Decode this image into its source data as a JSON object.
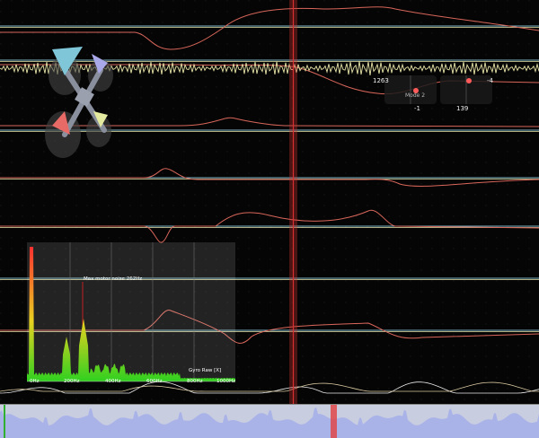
{
  "stick_display": {
    "left_stick": {
      "x_value": "1263",
      "y_value": "-1",
      "mode_label": "Mode 2"
    },
    "right_stick": {
      "x_value": "-4",
      "y_value": "139"
    }
  },
  "spectrum": {
    "title": "Max motor noise 262Hz",
    "axis_label": "Gyro Raw [X]",
    "ticks": [
      "0Hz",
      "200Hz",
      "400Hz",
      "600Hz",
      "800Hz",
      "1000Hz"
    ]
  },
  "colors": {
    "background": "#050505",
    "trace_red": "#d8665a",
    "trace_blue": "#7fb8c8",
    "trace_yellow": "#e8e5a8",
    "cursor": "#c83232",
    "timeline_fill": "#aab3e8",
    "motor1": "#7fc7d8",
    "motor2": "#a9a8e8",
    "motor3": "#e86a66",
    "motor4": "#e4e9a0"
  },
  "icons": {
    "quad": "quadcopter-icon",
    "cursor": "time-cursor",
    "timeline": "timeline-overview"
  }
}
